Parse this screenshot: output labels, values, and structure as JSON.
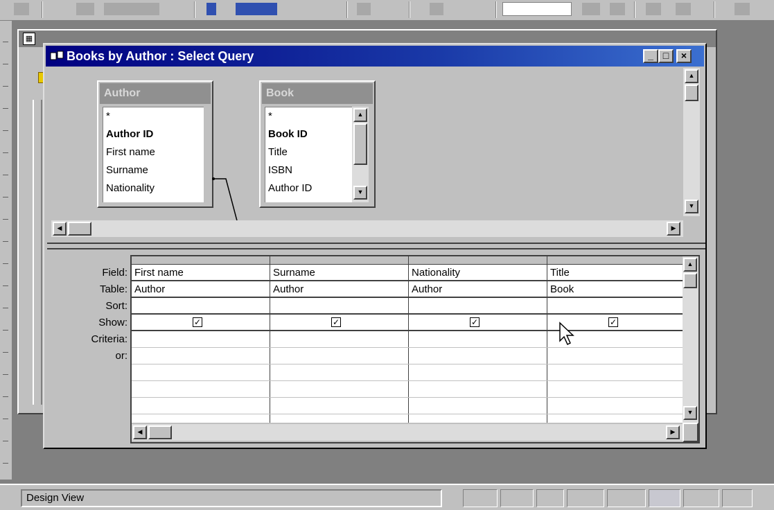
{
  "query_window": {
    "title": "Books by Author : Select Query",
    "controls": {
      "minimize": "_",
      "maximize": "□",
      "close": "×"
    }
  },
  "tables": [
    {
      "name": "Author",
      "fields": [
        "*",
        "Author ID",
        "First name",
        "Surname",
        "Nationality"
      ],
      "primary_key": "Author ID"
    },
    {
      "name": "Book",
      "fields": [
        "*",
        "Book ID",
        "Title",
        "ISBN",
        "Author ID"
      ],
      "primary_key": "Book ID"
    }
  ],
  "relationship": {
    "from": "Author.Author ID",
    "to": "Book.Author ID"
  },
  "grid": {
    "row_labels": [
      "Field:",
      "Table:",
      "Sort:",
      "Show:",
      "Criteria:",
      "or:"
    ],
    "columns": [
      {
        "field": "First name",
        "table": "Author",
        "sort": "",
        "show": true,
        "criteria": "",
        "or": ""
      },
      {
        "field": "Surname",
        "table": "Author",
        "sort": "",
        "show": true,
        "criteria": "",
        "or": ""
      },
      {
        "field": "Nationality",
        "table": "Author",
        "sort": "",
        "show": true,
        "criteria": "",
        "or": ""
      },
      {
        "field": "Title",
        "table": "Book",
        "sort": "",
        "show": true,
        "criteria": "",
        "or": ""
      }
    ]
  },
  "status_bar": {
    "text": "Design View"
  },
  "colors": {
    "title_bar": "#000080",
    "face": "#c0c0c0",
    "workspace": "#808080"
  }
}
